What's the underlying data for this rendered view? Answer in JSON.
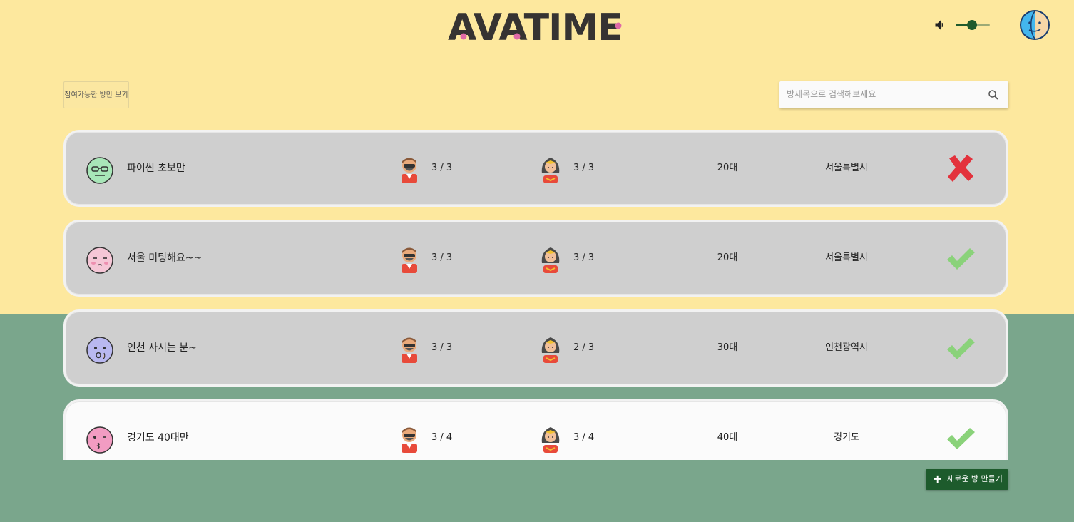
{
  "app": {
    "logo_text": "AVATIME"
  },
  "header": {
    "volume_level": 0.45
  },
  "toolbar": {
    "filter_label": "참여가능한 방만 보기",
    "search_placeholder": "방제목으로 검색해보세요"
  },
  "rooms": [
    {
      "title": "파이썬 초보만",
      "male": "3 / 3",
      "female": "3 / 3",
      "age": "20대",
      "region": "서울특별시",
      "status": "full"
    },
    {
      "title": "서울 미팅해요~~",
      "male": "3 / 3",
      "female": "3 / 3",
      "age": "20대",
      "region": "서울특별시",
      "status": "available"
    },
    {
      "title": "인천 사시는 분~",
      "male": "3 / 3",
      "female": "2 / 3",
      "age": "30대",
      "region": "인천광역시",
      "status": "available"
    },
    {
      "title": "경기도 40대만",
      "male": "3 / 4",
      "female": "3 / 4",
      "age": "40대",
      "region": "경기도",
      "status": "available"
    }
  ],
  "actions": {
    "create_room_label": "새로운 방 만들기"
  },
  "colors": {
    "top_bg": "#fde89e",
    "bottom_bg": "#7aa68c",
    "primary": "#1d5b2c",
    "check": "#8ad27a",
    "cross": "#e3323c"
  }
}
